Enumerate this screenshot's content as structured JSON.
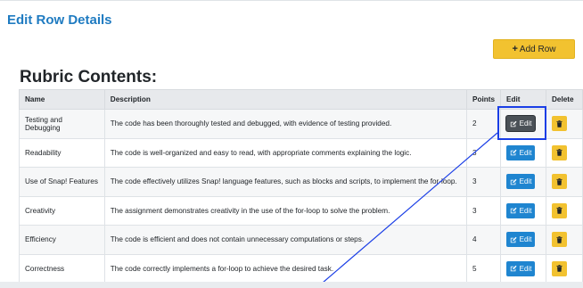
{
  "card": {
    "title": "Edit Row Details"
  },
  "actions": {
    "add_row_label": "Add Row",
    "add_row_icon": "plus-icon"
  },
  "section": {
    "title": "Rubric Contents:"
  },
  "table": {
    "headers": [
      "Name",
      "Description",
      "Points",
      "Edit",
      "Delete"
    ],
    "rows": [
      {
        "name": "Testing and Debugging",
        "description": "The code has been thoroughly tested and debugged, with evidence of testing provided.",
        "points": "2",
        "edit_label": "Edit"
      },
      {
        "name": "Readability",
        "description": "The code is well-organized and easy to read, with appropriate comments explaining the logic.",
        "points": "3",
        "edit_label": "Edit"
      },
      {
        "name": "Use of Snap! Features",
        "description": "The code effectively utilizes Snap! language features, such as blocks and scripts, to implement the for-loop.",
        "points": "3",
        "edit_label": "Edit"
      },
      {
        "name": "Creativity",
        "description": "The assignment demonstrates creativity in the use of the for-loop to solve the problem.",
        "points": "3",
        "edit_label": "Edit"
      },
      {
        "name": "Efficiency",
        "description": "The code is efficient and does not contain unnecessary computations or steps.",
        "points": "4",
        "edit_label": "Edit"
      },
      {
        "name": "Correctness",
        "description": "The code correctly implements a for-loop to achieve the desired task.",
        "points": "5",
        "edit_label": "Edit"
      }
    ]
  },
  "colors": {
    "title_blue": "#1f7bc1",
    "edit_blue": "#1f85d0",
    "active_edit": "#4b5157",
    "warning_yellow": "#f2c230",
    "highlight_box": "#1a3ee6"
  },
  "icons": {
    "edit": "edit-icon",
    "delete": "trash-icon"
  }
}
